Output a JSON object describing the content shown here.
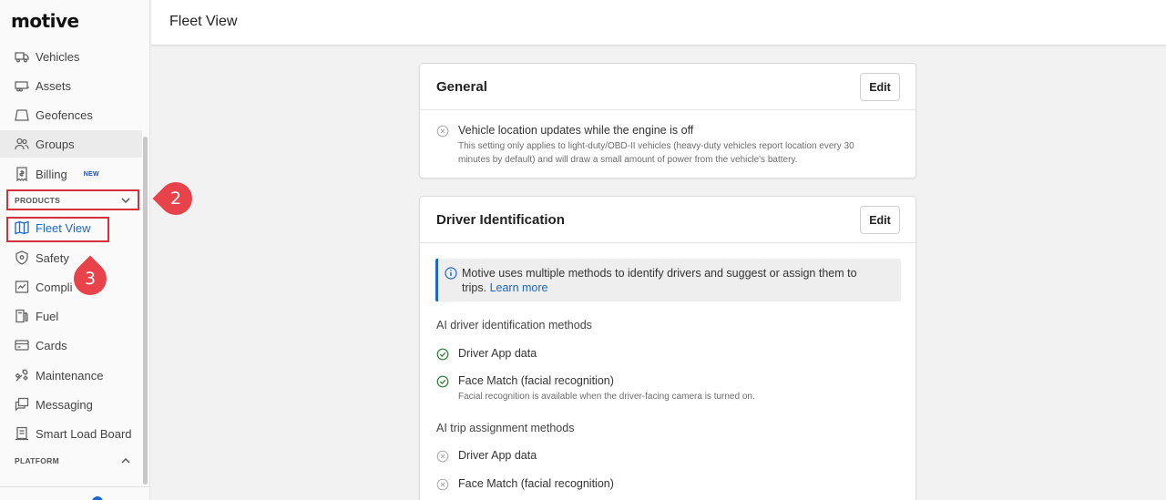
{
  "sidebar": {
    "logo": "motive",
    "items": [
      {
        "label": "Vehicles",
        "icon": "truck-icon"
      },
      {
        "label": "Assets",
        "icon": "trailer-icon"
      },
      {
        "label": "Geofences",
        "icon": "geofence-icon"
      },
      {
        "label": "Groups",
        "icon": "users-icon"
      },
      {
        "label": "Billing",
        "icon": "billing-icon",
        "badge": "NEW"
      }
    ],
    "products_header": "PRODUCTS",
    "products": [
      {
        "label": "Fleet View",
        "icon": "map-icon",
        "active": true
      },
      {
        "label": "Safety",
        "icon": "shield-icon"
      },
      {
        "label": "Compli",
        "icon": "compliance-icon"
      },
      {
        "label": "Fuel",
        "icon": "fuel-icon"
      },
      {
        "label": "Cards",
        "icon": "card-icon"
      },
      {
        "label": "Maintenance",
        "icon": "wrench-icon"
      },
      {
        "label": "Messaging",
        "icon": "message-icon"
      },
      {
        "label": "Smart Load Board",
        "icon": "load-board-icon"
      }
    ],
    "platform_header": "PLATFORM"
  },
  "annotations": {
    "step_products": "2",
    "step_fleet_view": "3"
  },
  "header": {
    "title": "Fleet View"
  },
  "general": {
    "title": "General",
    "edit_label": "Edit",
    "setting_label": "Vehicle location updates while the engine is off",
    "setting_desc_1": "This setting only applies to light-duty/OBD-II vehicles (heavy-duty vehicles report location every 30",
    "setting_desc_2": "minutes by default) and will draw a small amount of power from the vehicle's battery."
  },
  "driver_id": {
    "title": "Driver Identification",
    "edit_label": "Edit",
    "info_text_1": "Motive uses multiple methods to identify drivers and suggest or assign them to",
    "info_text_2": "trips.",
    "learn_more": "Learn more",
    "ai_methods_label": "AI driver identification methods",
    "method_1": "Driver App data",
    "method_2": "Face Match (facial recognition)",
    "method_2_desc": "Facial recognition is available when the driver-facing camera is turned on.",
    "trip_methods_label": "AI trip assignment methods",
    "trip_method_1": "Driver App data",
    "trip_method_2": "Face Match (facial recognition)"
  },
  "colors": {
    "accent": "#1b66c9",
    "annotation": "#e8434b",
    "check": "#2e7d32"
  }
}
